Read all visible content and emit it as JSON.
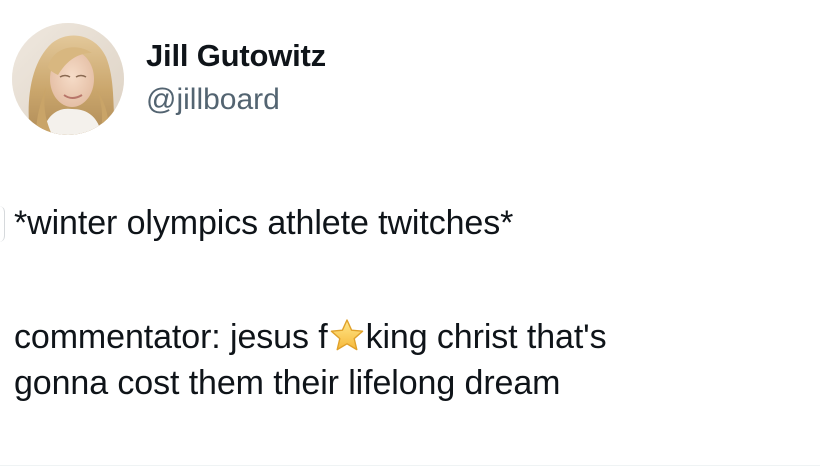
{
  "tweet": {
    "author": {
      "display_name": "Jill Gutowitz",
      "handle": "@jillboard",
      "avatar_icon": "profile-photo-avatar"
    },
    "text": {
      "line1": "*winter olympics athlete twitches*",
      "line2_before": "commentator: jesus f",
      "line2_emoji": "star-emoji",
      "line2_after": "king christ that's",
      "line3": "gonna cost them their lifelong dream"
    }
  }
}
